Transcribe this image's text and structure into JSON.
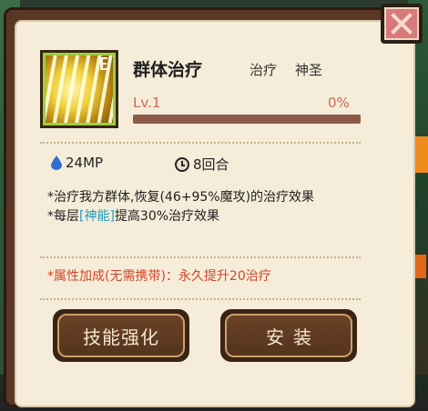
{
  "skill": {
    "name": "群体治疗",
    "tags": [
      "治疗",
      "神圣"
    ],
    "level": "Lv.1",
    "progress_text": "0%",
    "progress_fraction": 0,
    "icon": "holy-light-skill-icon"
  },
  "stats": {
    "mp": "24MP",
    "rounds": "8回合"
  },
  "description": {
    "line1": "*治疗我方群体,恢复(46+95%魔攻)的治疗效果",
    "line2_prefix": "*每层",
    "line2_highlight": "[神能]",
    "line2_suffix": "提高30%治疗效果"
  },
  "attribute_bonus": "*属性加成(无需携带)：永久提升20治疗",
  "buttons": {
    "upgrade": "技能强化",
    "equip": "安装"
  },
  "colors": {
    "panel_bg": "#f5ecd9",
    "frame": "#5a3724",
    "accent_red": "#d04626",
    "highlight_blue": "#1f9ec0",
    "level_text": "#c96a55"
  }
}
